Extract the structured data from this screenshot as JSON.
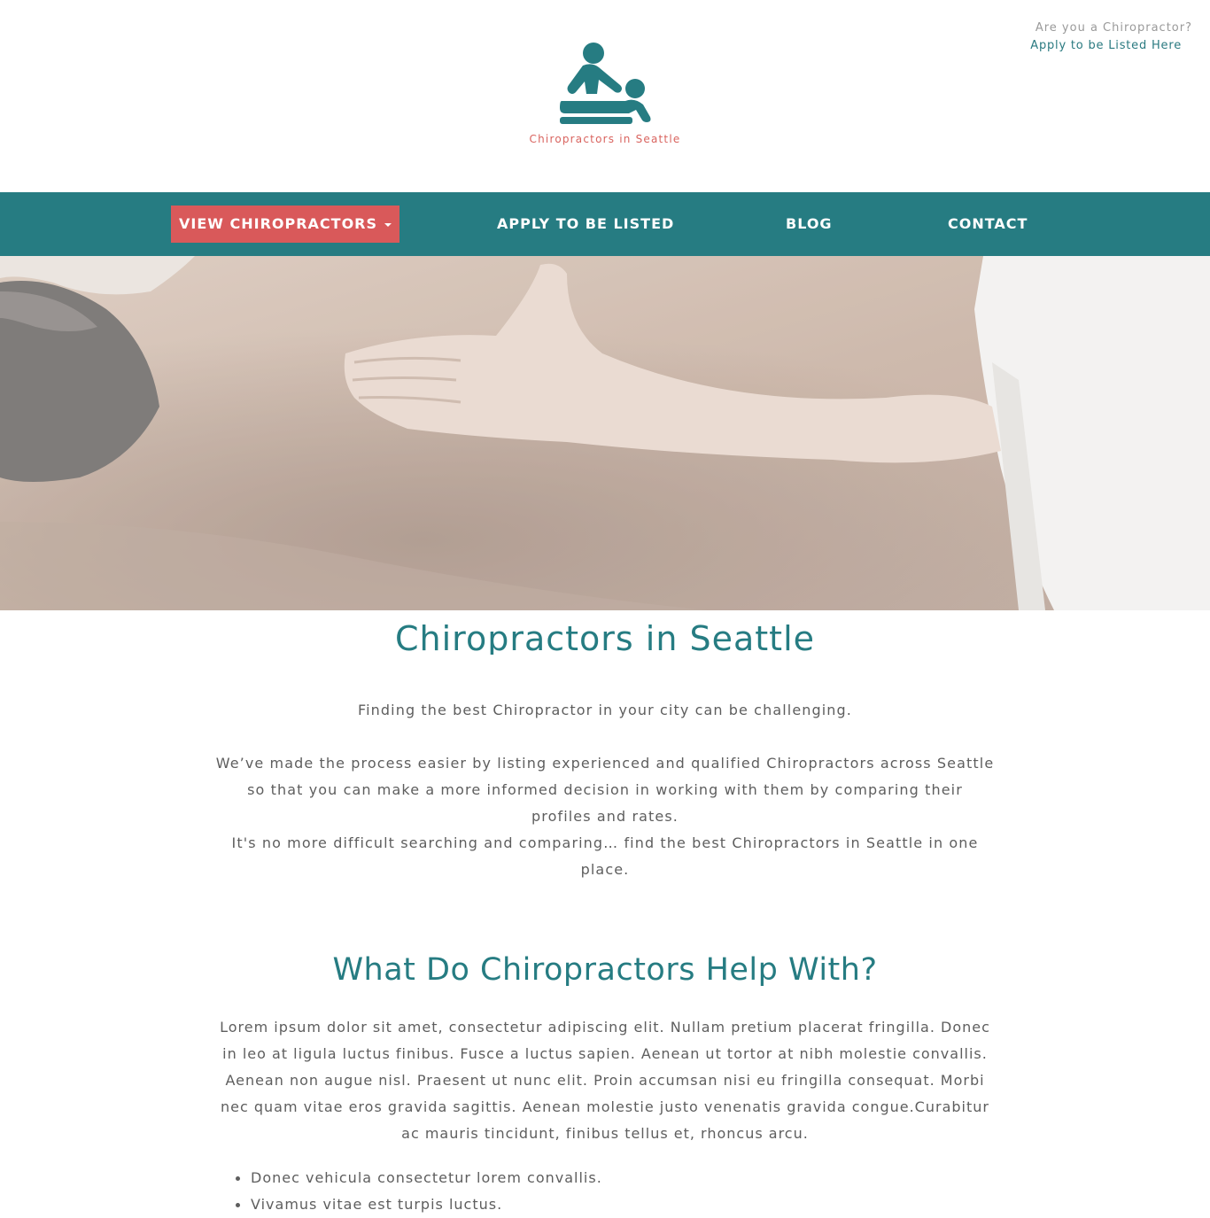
{
  "header": {
    "question": "Are you a Chiropractor?",
    "apply_link": "Apply to be Listed Here",
    "logo_tagline": "Chiropractors in Seattle"
  },
  "nav": {
    "items": [
      {
        "label": "VIEW CHIROPRACTORS"
      },
      {
        "label": "APPLY TO BE LISTED"
      },
      {
        "label": "BLOG"
      },
      {
        "label": "CONTACT"
      }
    ]
  },
  "main": {
    "title": "Chiropractors in Seattle",
    "intro_p1": "Finding the best Chiropractor in your city can be challenging.",
    "intro_p2": "We’ve made the process easier by listing experienced and qualified Chiropractors across Seattle so that you can make a more informed decision in working with them by comparing their profiles and rates.",
    "intro_p3": "It's no more difficult searching and comparing… find the best Chiropractors in Seattle in one place.",
    "section_title": "What Do Chiropractors Help With?",
    "lorem": "Lorem ipsum dolor sit amet, consectetur adipiscing elit. Nullam pretium placerat fringilla. Donec in leo at ligula luctus finibus. Fusce a luctus sapien. Aenean ut tortor at nibh molestie convallis. Aenean non augue nisl. Praesent ut nunc elit. Proin accumsan nisi eu fringilla consequat. Morbi nec quam vitae eros gravida sagittis. Aenean molestie justo venenatis gravida congue.Curabitur ac mauris tincidunt, finibus tellus et, rhoncus arcu.",
    "bullets": [
      "Donec vehicula consectetur lorem convallis.",
      "Vivamus vitae est turpis luctus."
    ]
  },
  "colors": {
    "brand_teal": "#267c82",
    "accent_red": "#d9595a",
    "logo_text": "#d9645f"
  }
}
